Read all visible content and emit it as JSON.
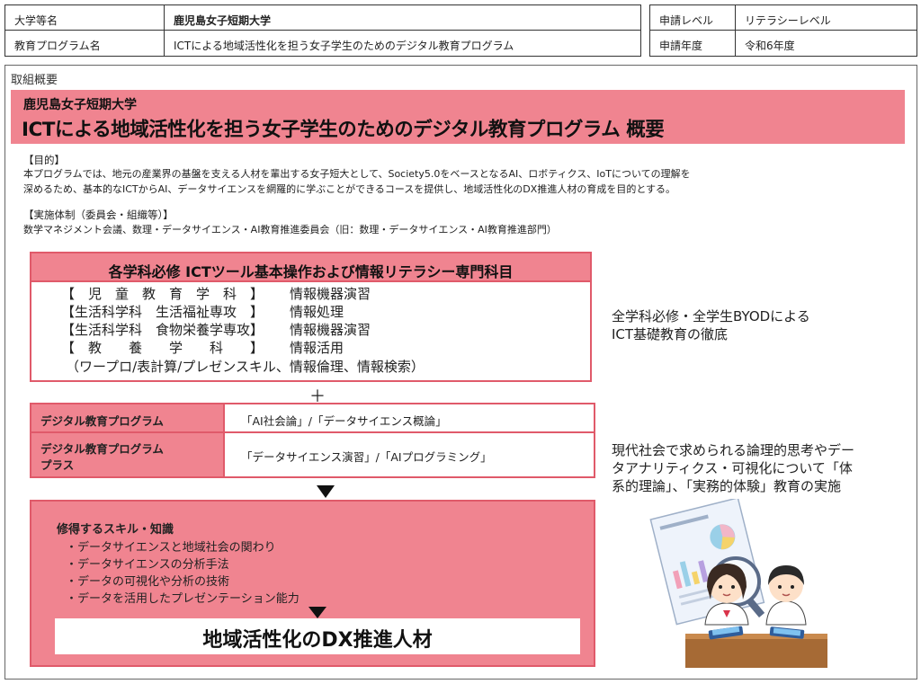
{
  "header": {
    "university_label": "大学等名",
    "university_value": "鹿児島女子短期大学",
    "program_label": "教育プログラム名",
    "program_value": "ICTによる地域活性化を担う女子学生のためのデジタル教育プログラム",
    "level_label": "申請レベル",
    "level_value": "リテラシーレベル",
    "year_label": "申請年度",
    "year_value": "令和6年度"
  },
  "overview": {
    "section_label": "取組概要",
    "banner_org": "鹿児島女子短期大学",
    "banner_title": "ICTによる地域活性化を担う女子学生のためのデジタル教育プログラム 概要",
    "purpose_head": "【目的】",
    "purpose_line1": "本プログラムでは、地元の産業界の基盤を支える人材を輩出する女子短大として、Society5.0をベースとなるAI、ロボティクス、IoTについての理解を",
    "purpose_line2": "深めるため、基本的なICTからAI、データサイエンスを網羅的に学ぶことができるコースを提供し、地域活性化のDX推進人材の育成を目的とする。",
    "system_head": "【実施体制（委員会・組織等）】",
    "system_line": "数学マネジメント会議、数理・データサイエンス・AI教育推進委員会（旧：数理・データサイエンス・AI教育推進部門）"
  },
  "required": {
    "title": "各学科必修 ICTツール基本操作および情報リテラシー専門科目",
    "rows": [
      {
        "dept": "【　児　童　教　育　学　科　】",
        "course": "情報機器演習"
      },
      {
        "dept": "【生活科学科　生活福祉専攻　】",
        "course": "情報処理"
      },
      {
        "dept": "【生活科学科　食物栄養学専攻】",
        "course": "情報機器演習"
      },
      {
        "dept": "【　教　　養　　学　　科　　】",
        "course": "情報活用"
      }
    ],
    "note": "（ワープロ/表計算/プレゼンスキル、情報倫理、情報検索）",
    "side_note_1": "全学科必修・全学生BYODによる",
    "side_note_2": "ICT基礎教育の徹底"
  },
  "plus": "＋",
  "digital": {
    "row1_label": "デジタル教育プログラム",
    "row1_value": "「AI社会論」/「データサイエンス概論」",
    "row2_label_1": "デジタル教育プログラム",
    "row2_label_2": "プラス",
    "row2_value": "「データサイエンス演習」/「AIプログラミング」",
    "side_note_1": "現代社会で求められる論理的思考やデー",
    "side_note_2": "タアナリティクス・可視化について「体",
    "side_note_3": "系的理論」、「実務的体験」教育の実施"
  },
  "skills": {
    "title": "修得するスキル・知識",
    "items": [
      "・データサイエンスと地域社会の関わり",
      "・データサイエンスの分析手法",
      "・データの可視化や分析の技術",
      "・データを活用したプレゼンテーション能力"
    ],
    "goal": "地域活性化のDX推進人材"
  },
  "colors": {
    "pink": "#f08490",
    "pink_border": "#e05a6a"
  },
  "illustration": "students-with-tablets-and-chart-report"
}
